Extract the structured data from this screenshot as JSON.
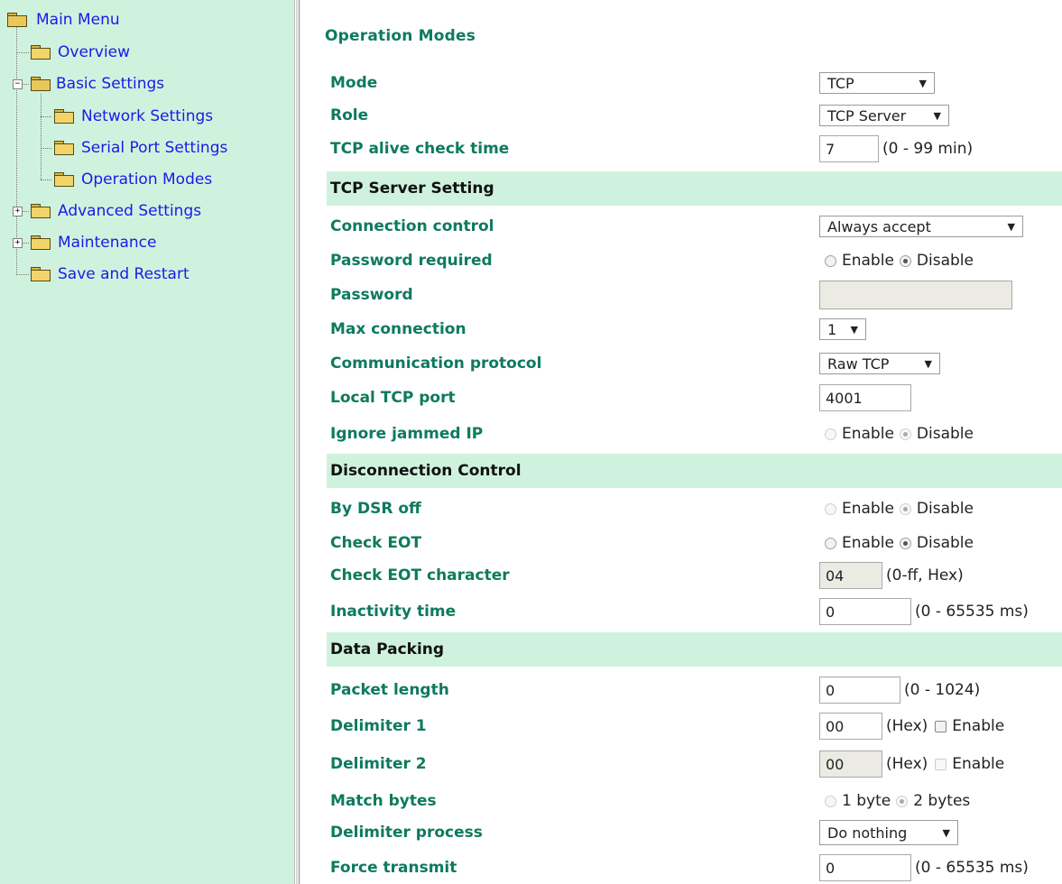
{
  "sidebar": {
    "items": [
      {
        "label": "Main Menu",
        "icon": "folder-open-icon"
      },
      {
        "label": "Overview",
        "icon": "folder-icon"
      },
      {
        "label": "Basic Settings",
        "icon": "folder-open-icon"
      },
      {
        "label": "Network Settings",
        "icon": "folder-icon"
      },
      {
        "label": "Serial Port Settings",
        "icon": "folder-icon"
      },
      {
        "label": "Operation Modes",
        "icon": "folder-icon"
      },
      {
        "label": "Advanced Settings",
        "icon": "folder-icon"
      },
      {
        "label": "Maintenance",
        "icon": "folder-icon"
      },
      {
        "label": "Save and Restart",
        "icon": "folder-icon"
      }
    ]
  },
  "page": {
    "title": "Operation Modes"
  },
  "form": {
    "mode": {
      "label": "Mode",
      "value": "TCP"
    },
    "role": {
      "label": "Role",
      "value": "TCP Server"
    },
    "alive": {
      "label": "TCP alive check time",
      "value": "7",
      "hint": "(0 - 99 min)"
    },
    "sec_server": "TCP Server Setting",
    "conn_control": {
      "label": "Connection control",
      "value": "Always accept"
    },
    "pwd_required": {
      "label": "Password required",
      "opt1": "Enable",
      "opt2": "Disable"
    },
    "password": {
      "label": "Password",
      "value": ""
    },
    "max_conn": {
      "label": "Max connection",
      "value": "1"
    },
    "protocol": {
      "label": "Communication protocol",
      "value": "Raw TCP"
    },
    "local_port": {
      "label": "Local TCP port",
      "value": "4001"
    },
    "ignore_ip": {
      "label": "Ignore jammed IP",
      "opt1": "Enable",
      "opt2": "Disable"
    },
    "sec_disconnect": "Disconnection Control",
    "dsr_off": {
      "label": "By DSR off",
      "opt1": "Enable",
      "opt2": "Disable"
    },
    "check_eot": {
      "label": "Check EOT",
      "opt1": "Enable",
      "opt2": "Disable"
    },
    "eot_char": {
      "label": "Check EOT character",
      "value": "04",
      "hint": "(0-ff, Hex)"
    },
    "inactivity": {
      "label": "Inactivity time",
      "value": "0",
      "hint": "(0 - 65535 ms)"
    },
    "sec_packing": "Data Packing",
    "packet_len": {
      "label": "Packet length",
      "value": "0",
      "hint": "(0 - 1024)"
    },
    "delim1": {
      "label": "Delimiter 1",
      "value": "00",
      "hint": "(Hex)",
      "check": "Enable"
    },
    "delim2": {
      "label": "Delimiter 2",
      "value": "00",
      "hint": "(Hex)",
      "check": "Enable"
    },
    "match": {
      "label": "Match bytes",
      "opt1": "1 byte",
      "opt2": "2 bytes"
    },
    "delim_process": {
      "label": "Delimiter process",
      "value": "Do nothing"
    },
    "force": {
      "label": "Force transmit",
      "value": "0",
      "hint": "(0 - 65535 ms)"
    }
  }
}
